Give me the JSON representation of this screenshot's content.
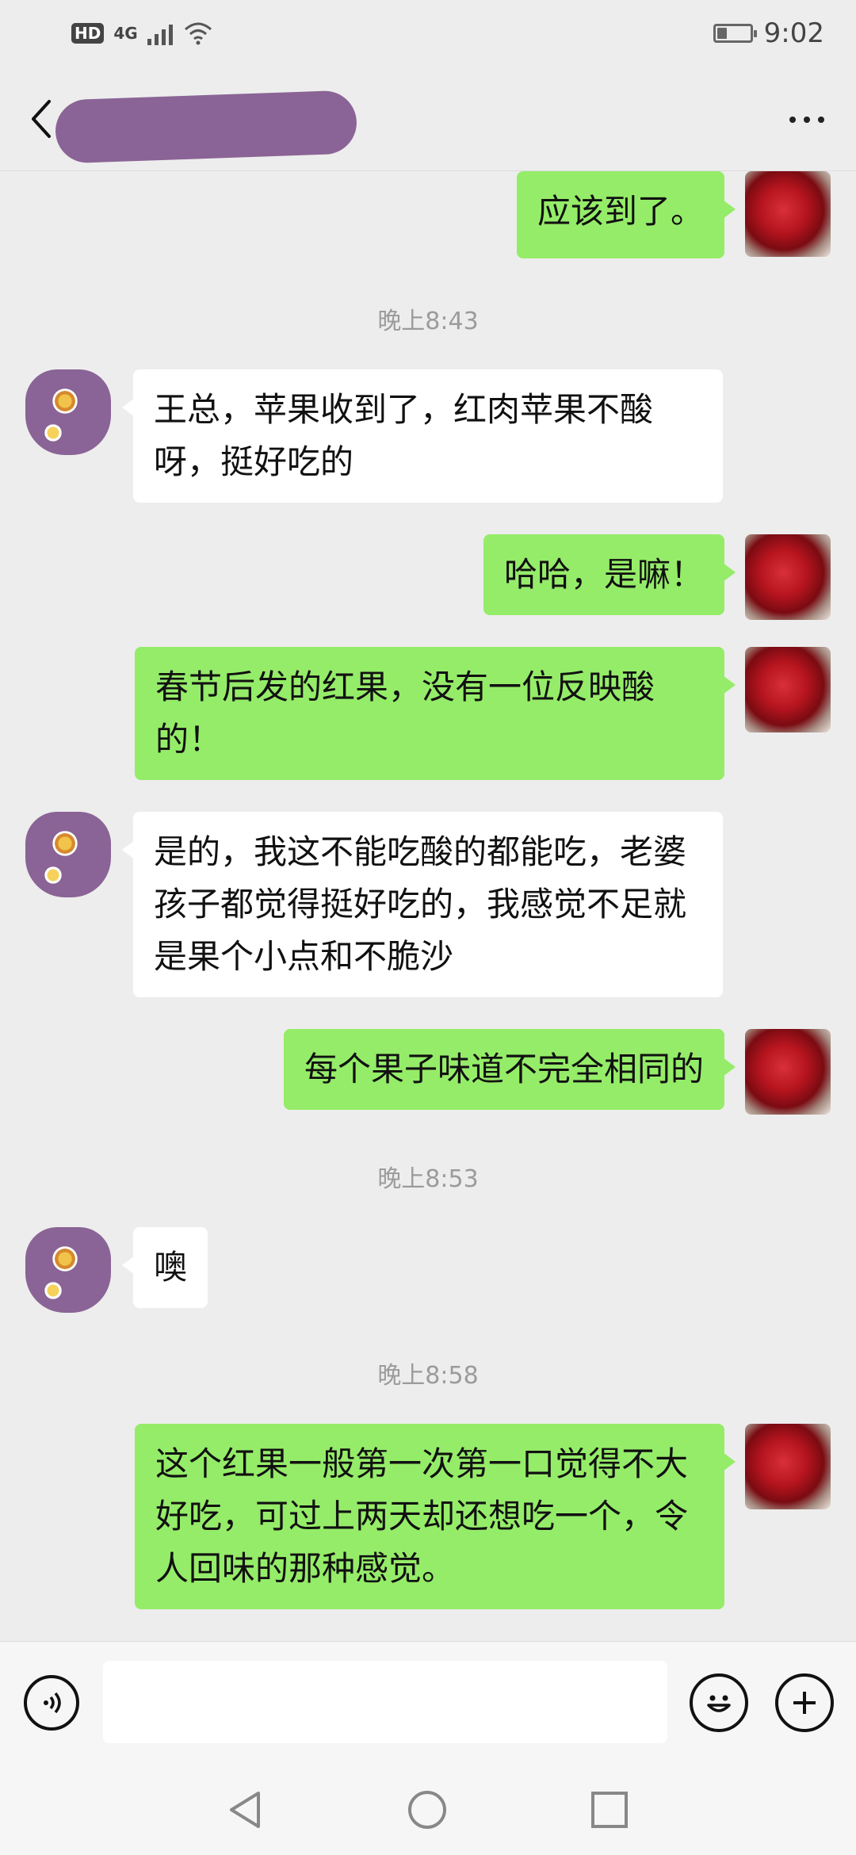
{
  "status_bar": {
    "hd": "HD",
    "network": "4G",
    "time": "9:02",
    "battery_level": 0.3
  },
  "header": {
    "more_label": "..."
  },
  "messages": [
    {
      "side": "me",
      "text": "应该到了。"
    },
    {
      "timestamp": "晚上8:43"
    },
    {
      "side": "other",
      "text": "王总，苹果收到了，红肉苹果不酸呀，挺好吃的"
    },
    {
      "side": "me",
      "text": "哈哈，是嘛！"
    },
    {
      "side": "me",
      "text": "春节后发的红果，没有一位反映酸的！"
    },
    {
      "side": "other",
      "text": "是的，我这不能吃酸的都能吃，老婆孩子都觉得挺好吃的，我感觉不足就是果个小点和不脆沙"
    },
    {
      "side": "me",
      "text": "每个果子味道不完全相同的"
    },
    {
      "timestamp": "晚上8:53"
    },
    {
      "side": "other",
      "text": "噢"
    },
    {
      "timestamp": "晚上8:58"
    },
    {
      "side": "me",
      "text": "这个红果一般第一次第一口觉得不大好吃，可过上两天却还想吃一个，令人回味的那种感觉。"
    }
  ],
  "input": {
    "value": "",
    "placeholder": ""
  },
  "colors": {
    "me_bubble": "#95ec69",
    "other_bubble": "#ffffff",
    "background": "#ededed"
  }
}
